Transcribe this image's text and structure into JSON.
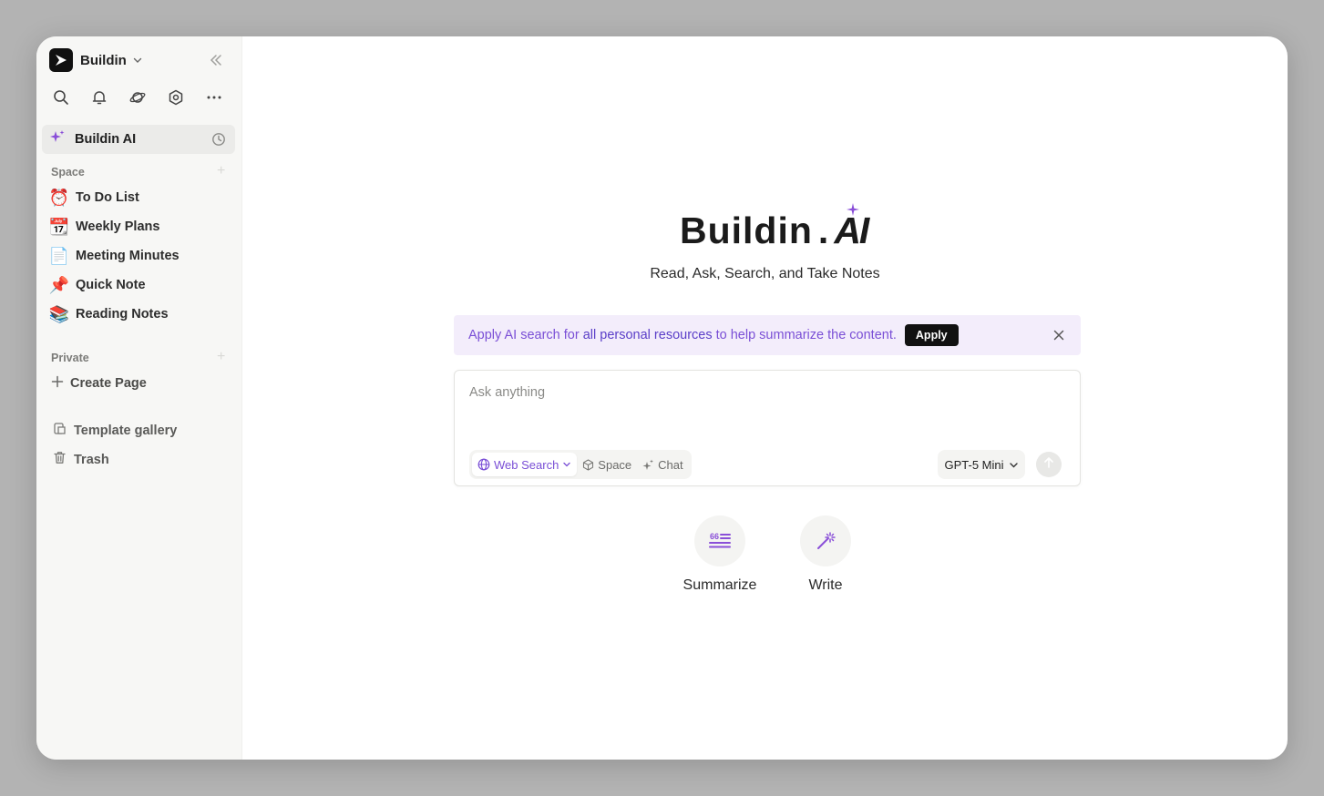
{
  "workspace": {
    "name": "Buildin"
  },
  "sidebar": {
    "ai_item": {
      "label": "Buildin AI"
    },
    "space_label": "Space",
    "space_pages": [
      {
        "emoji": "⏰",
        "label": "To Do List"
      },
      {
        "emoji": "📆",
        "label": "Weekly Plans"
      },
      {
        "emoji": "📄",
        "label": "Meeting Minutes"
      },
      {
        "emoji": "📌",
        "label": "Quick Note"
      },
      {
        "emoji": "📚",
        "label": "Reading Notes"
      }
    ],
    "private_label": "Private",
    "create_page": "Create Page",
    "template_gallery": "Template gallery",
    "trash": "Trash"
  },
  "brand": {
    "word": "Buildin",
    "dot": ".",
    "ai": "AI"
  },
  "tagline": "Read, Ask, Search, and Take Notes",
  "banner": {
    "text_pre": "Apply AI search for ",
    "text_hl": "all personal resources",
    "text_post": " to help summarize the content.",
    "apply_label": "Apply"
  },
  "ask": {
    "placeholder": "Ask anything",
    "modes": [
      {
        "label": "Web Search",
        "icon": "globe-icon",
        "active": true
      },
      {
        "label": "Space",
        "icon": "cube-icon",
        "active": false
      },
      {
        "label": "Chat",
        "icon": "sparkle-icon",
        "active": false
      }
    ],
    "model": "GPT-5 Mini"
  },
  "quick_actions": [
    {
      "label": "Summarize",
      "icon": "summarize-icon"
    },
    {
      "label": "Write",
      "icon": "magic-wand-icon"
    }
  ],
  "colors": {
    "accent": "#7a4fd6",
    "banner_bg": "#f3edfb",
    "sidebar_bg": "#f7f7f5"
  }
}
